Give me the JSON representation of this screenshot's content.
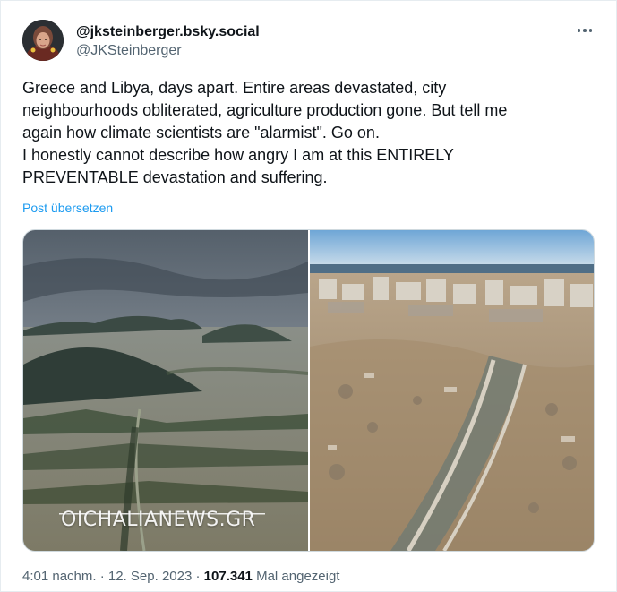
{
  "author": {
    "display_name": "@jksteinberger.bsky.social",
    "handle": "@JKSteinberger",
    "avatar_icon": "avatar-portrait"
  },
  "menu": {
    "icon": "more-dots-icon"
  },
  "tweet": {
    "lines": [
      "Greece and Libya, days apart. Entire areas devastated, city",
      "neighbourhoods obliterated, agriculture production gone. But tell me",
      "again how climate scientists are \"alarmist\". Go on.",
      "I honestly cannot describe how angry I am at this ENTIRELY",
      "PREVENTABLE devastation and suffering."
    ],
    "translate_label": "Post übersetzen"
  },
  "media": {
    "left_watermark": "OICHALIANEWS.GR"
  },
  "meta": {
    "time": "4:01 nachm.",
    "sep1": "·",
    "date": "12. Sep. 2023",
    "sep2": "·",
    "views_count": "107.341",
    "views_label": "Mal angezeigt"
  },
  "colors": {
    "link": "#1d9bf0",
    "secondary_text": "#536471",
    "primary_text": "#0f1419"
  }
}
